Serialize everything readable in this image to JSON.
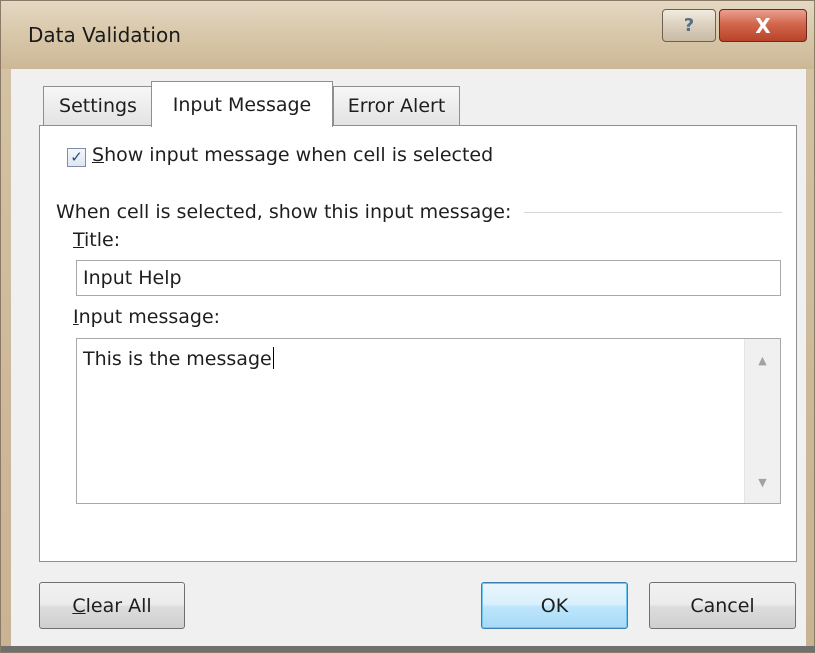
{
  "window": {
    "title": "Data Validation",
    "help_glyph": "?",
    "close_glyph": "X"
  },
  "tabs": [
    {
      "label": "Settings",
      "active": false
    },
    {
      "label": "Input Message",
      "active": true
    },
    {
      "label": "Error Alert",
      "active": false
    }
  ],
  "input_message": {
    "show_checkbox": {
      "checked": true,
      "label_first": "S",
      "label_rest": "how input message when cell is selected"
    },
    "group_label": "When cell is selected, show this input message:",
    "title_label_first": "T",
    "title_label_rest": "itle:",
    "title_value": "Input Help",
    "message_label_first": "I",
    "message_label_rest": "nput message:",
    "message_value": "This is the message"
  },
  "buttons": {
    "clear_all_first": "C",
    "clear_all_rest": "lear All",
    "ok": "OK",
    "cancel": "Cancel"
  },
  "icons": {
    "checkmark": "✓",
    "scroll_up": "▲",
    "scroll_down": "▼"
  },
  "colors": {
    "titlebar": "#d8c7a9",
    "close_button": "#c4503a",
    "default_button_border": "#3c7fb1"
  }
}
